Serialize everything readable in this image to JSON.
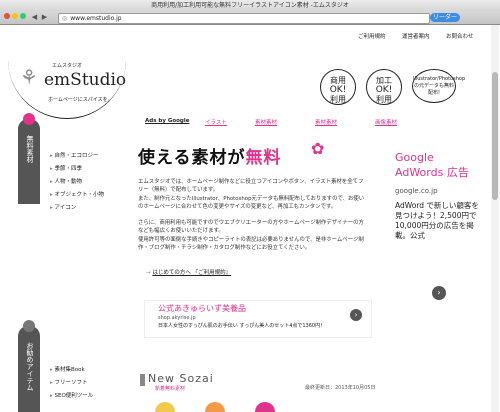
{
  "browser": {
    "title": "商用利用/加工利用可能な無料フリーイラストアイコン素材 -エムスタジオ",
    "url": "www.emstudio.jp",
    "reader_label": "リーダー"
  },
  "topnav": [
    "ご利用規約",
    "運営者案内",
    "お問合わせ"
  ],
  "logo": {
    "katakana": "エムスタジオ",
    "name": "emStudio",
    "tagline": "ホームページにスパイスを。"
  },
  "badges": [
    {
      "line1": "商用",
      "line2": "利用",
      "ok": "OK!"
    },
    {
      "line1": "加工",
      "line2": "利用",
      "ok": "OK!"
    }
  ],
  "badge_note": "Illustrator/Photoshop\nの元データも無料配布!",
  "ads_by_google": "Ads by Google",
  "categories": [
    "イラスト",
    "素材素材",
    "素材素材",
    "画像素材"
  ],
  "sidebar": {
    "section1_label": "無料素材",
    "section1_items": [
      "自然・エコロジー",
      "季節・四季",
      "人物・動物",
      "オブジェクト・小物",
      "アイコン"
    ],
    "section2_label": "お勧めアイテム",
    "section2_items": [
      "素材集Book",
      "フリーソフト",
      "SEO便利ツール"
    ]
  },
  "main": {
    "headline_prefix": "使える素材が",
    "headline_highlight": "無料",
    "para1": "エムスタジオでは、ホームページ制作などに役立つアイコンやボタン、イラスト素材を全てフリー（無料）で配布しています。",
    "para2": "また、制作元となったIllustrator、Photoshop元データも無料配布しておりますので、お使いのホームページに合わせて色の変更やサイズの変更など、再加工もカンタンです。",
    "para3": "さらに、商用利用も可能ですのでウエブクリエーターの方やホームページ制作デザイナーの方なども幅広くお使いいただけます。",
    "para4": "使用許可等の面倒な手続きやコピーライトの表記は必要ありませんので、是非ホームページ制作・ブログ制作・チラシ制作・カタログ制作などにお役立てください。",
    "first_link": "はじめての方へ 『ご利用規約』"
  },
  "google_ad": {
    "title": "Google AdWords 広告",
    "url": "google.co.jp",
    "desc": "AdWord で新しい顧客を見つけよう！2,500円で10,000円分の広告を掲載。公式"
  },
  "shop_ad": {
    "title": "公式あきゅらいず美養品",
    "url": "shop.akyrise.jp",
    "desc": "日本人女性のすっぴん肌のお手伝い すっぴん美人のセット4点で1360円！"
  },
  "new_section": {
    "title": "New Sozai",
    "sub": "新着無料素材",
    "updated": "最終更新日：2013年10月05日"
  }
}
